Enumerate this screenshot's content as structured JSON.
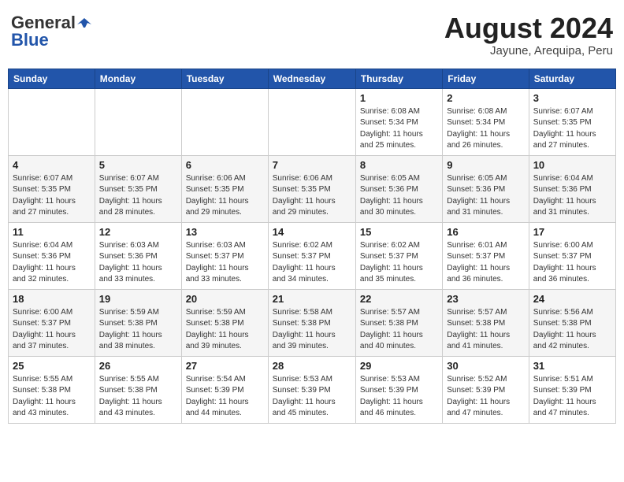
{
  "header": {
    "logo_general": "General",
    "logo_blue": "Blue",
    "month_title": "August 2024",
    "location": "Jayune, Arequipa, Peru"
  },
  "days_of_week": [
    "Sunday",
    "Monday",
    "Tuesday",
    "Wednesday",
    "Thursday",
    "Friday",
    "Saturday"
  ],
  "weeks": [
    [
      {
        "day": "",
        "info": ""
      },
      {
        "day": "",
        "info": ""
      },
      {
        "day": "",
        "info": ""
      },
      {
        "day": "",
        "info": ""
      },
      {
        "day": "1",
        "info": "Sunrise: 6:08 AM\nSunset: 5:34 PM\nDaylight: 11 hours\nand 25 minutes."
      },
      {
        "day": "2",
        "info": "Sunrise: 6:08 AM\nSunset: 5:34 PM\nDaylight: 11 hours\nand 26 minutes."
      },
      {
        "day": "3",
        "info": "Sunrise: 6:07 AM\nSunset: 5:35 PM\nDaylight: 11 hours\nand 27 minutes."
      }
    ],
    [
      {
        "day": "4",
        "info": "Sunrise: 6:07 AM\nSunset: 5:35 PM\nDaylight: 11 hours\nand 27 minutes."
      },
      {
        "day": "5",
        "info": "Sunrise: 6:07 AM\nSunset: 5:35 PM\nDaylight: 11 hours\nand 28 minutes."
      },
      {
        "day": "6",
        "info": "Sunrise: 6:06 AM\nSunset: 5:35 PM\nDaylight: 11 hours\nand 29 minutes."
      },
      {
        "day": "7",
        "info": "Sunrise: 6:06 AM\nSunset: 5:35 PM\nDaylight: 11 hours\nand 29 minutes."
      },
      {
        "day": "8",
        "info": "Sunrise: 6:05 AM\nSunset: 5:36 PM\nDaylight: 11 hours\nand 30 minutes."
      },
      {
        "day": "9",
        "info": "Sunrise: 6:05 AM\nSunset: 5:36 PM\nDaylight: 11 hours\nand 31 minutes."
      },
      {
        "day": "10",
        "info": "Sunrise: 6:04 AM\nSunset: 5:36 PM\nDaylight: 11 hours\nand 31 minutes."
      }
    ],
    [
      {
        "day": "11",
        "info": "Sunrise: 6:04 AM\nSunset: 5:36 PM\nDaylight: 11 hours\nand 32 minutes."
      },
      {
        "day": "12",
        "info": "Sunrise: 6:03 AM\nSunset: 5:36 PM\nDaylight: 11 hours\nand 33 minutes."
      },
      {
        "day": "13",
        "info": "Sunrise: 6:03 AM\nSunset: 5:37 PM\nDaylight: 11 hours\nand 33 minutes."
      },
      {
        "day": "14",
        "info": "Sunrise: 6:02 AM\nSunset: 5:37 PM\nDaylight: 11 hours\nand 34 minutes."
      },
      {
        "day": "15",
        "info": "Sunrise: 6:02 AM\nSunset: 5:37 PM\nDaylight: 11 hours\nand 35 minutes."
      },
      {
        "day": "16",
        "info": "Sunrise: 6:01 AM\nSunset: 5:37 PM\nDaylight: 11 hours\nand 36 minutes."
      },
      {
        "day": "17",
        "info": "Sunrise: 6:00 AM\nSunset: 5:37 PM\nDaylight: 11 hours\nand 36 minutes."
      }
    ],
    [
      {
        "day": "18",
        "info": "Sunrise: 6:00 AM\nSunset: 5:37 PM\nDaylight: 11 hours\nand 37 minutes."
      },
      {
        "day": "19",
        "info": "Sunrise: 5:59 AM\nSunset: 5:38 PM\nDaylight: 11 hours\nand 38 minutes."
      },
      {
        "day": "20",
        "info": "Sunrise: 5:59 AM\nSunset: 5:38 PM\nDaylight: 11 hours\nand 39 minutes."
      },
      {
        "day": "21",
        "info": "Sunrise: 5:58 AM\nSunset: 5:38 PM\nDaylight: 11 hours\nand 39 minutes."
      },
      {
        "day": "22",
        "info": "Sunrise: 5:57 AM\nSunset: 5:38 PM\nDaylight: 11 hours\nand 40 minutes."
      },
      {
        "day": "23",
        "info": "Sunrise: 5:57 AM\nSunset: 5:38 PM\nDaylight: 11 hours\nand 41 minutes."
      },
      {
        "day": "24",
        "info": "Sunrise: 5:56 AM\nSunset: 5:38 PM\nDaylight: 11 hours\nand 42 minutes."
      }
    ],
    [
      {
        "day": "25",
        "info": "Sunrise: 5:55 AM\nSunset: 5:38 PM\nDaylight: 11 hours\nand 43 minutes."
      },
      {
        "day": "26",
        "info": "Sunrise: 5:55 AM\nSunset: 5:38 PM\nDaylight: 11 hours\nand 43 minutes."
      },
      {
        "day": "27",
        "info": "Sunrise: 5:54 AM\nSunset: 5:39 PM\nDaylight: 11 hours\nand 44 minutes."
      },
      {
        "day": "28",
        "info": "Sunrise: 5:53 AM\nSunset: 5:39 PM\nDaylight: 11 hours\nand 45 minutes."
      },
      {
        "day": "29",
        "info": "Sunrise: 5:53 AM\nSunset: 5:39 PM\nDaylight: 11 hours\nand 46 minutes."
      },
      {
        "day": "30",
        "info": "Sunrise: 5:52 AM\nSunset: 5:39 PM\nDaylight: 11 hours\nand 47 minutes."
      },
      {
        "day": "31",
        "info": "Sunrise: 5:51 AM\nSunset: 5:39 PM\nDaylight: 11 hours\nand 47 minutes."
      }
    ]
  ]
}
